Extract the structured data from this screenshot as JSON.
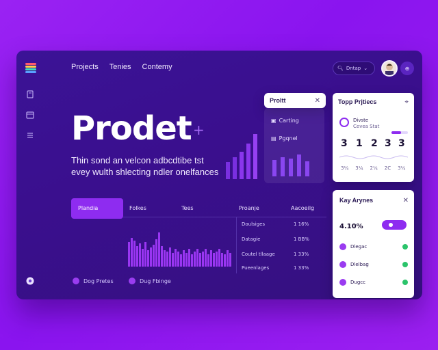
{
  "nav": [
    "Projects",
    "Tenies",
    "Contemy"
  ],
  "search": {
    "label": "Dntap"
  },
  "hero": {
    "title": "Prodet",
    "subtitle_line1": "Thin sond an velcon adbcdtibe tst",
    "subtitle_line2": "evey wulth shlecting ndler onelfances"
  },
  "project_panel": {
    "title": "Proltt",
    "rows": [
      "Carting",
      "Pgqnel"
    ]
  },
  "top_projects": {
    "title": "Topp Prjtiecs",
    "item_name": "Divste",
    "item_sub": "Cevea Stat",
    "values": [
      "3",
      "1",
      "2",
      "3",
      "3"
    ],
    "ticks": [
      "3¼",
      "3¼",
      "2¼",
      "2C",
      "3¼"
    ]
  },
  "key_panel": {
    "title": "Kay Arynes",
    "percent": "4.10%",
    "items": [
      "Dlegac",
      "Dlelbag",
      "Dugcc"
    ]
  },
  "table": {
    "tab": "Plandia",
    "headers": [
      "Folkes",
      "Tees",
      "Proanje",
      "Aacoeilg"
    ],
    "rows": [
      [
        "Doulsiges",
        "1 16%"
      ],
      [
        "Datagie",
        "1 BB%"
      ],
      [
        "Coutel tllaage",
        "1 33%"
      ],
      [
        "Pueenlages",
        "1 33%"
      ]
    ]
  },
  "legend": [
    "Dog Pretes",
    "Dug Fbinge"
  ],
  "colors": {
    "accent": "#8e2cf0",
    "background": "#8a14ef",
    "panel": "#3a0f8e"
  }
}
